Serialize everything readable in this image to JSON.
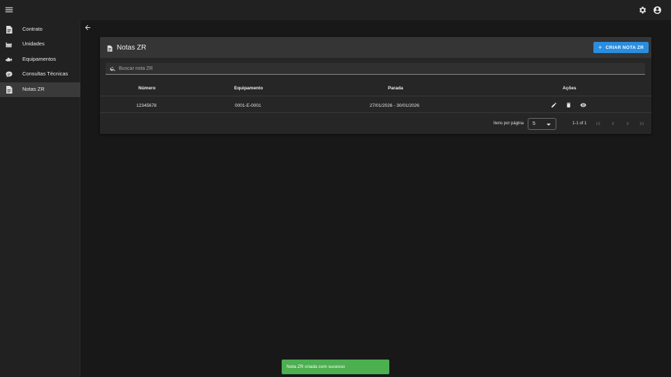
{
  "topbar": {
    "menu_icon": "menu-icon",
    "settings_icon": "gear-icon",
    "account_icon": "account-circle-icon"
  },
  "sidebar": {
    "items": [
      {
        "label": "Contrato",
        "icon": "file-document-icon",
        "active": false
      },
      {
        "label": "Unidades",
        "icon": "factory-icon",
        "active": false
      },
      {
        "label": "Equipamentos",
        "icon": "pump-icon",
        "active": false
      },
      {
        "label": "Consultas Técnicas",
        "icon": "chat-bubble-icon",
        "active": false
      },
      {
        "label": "Notas ZR",
        "icon": "file-document-icon",
        "active": true
      }
    ]
  },
  "main": {
    "back_icon": "arrow-left-icon",
    "card": {
      "title": "Notas ZR",
      "title_icon": "file-document-icon",
      "create_button": {
        "icon": "plus-icon",
        "label": "CRIAR NOTA ZR"
      },
      "search": {
        "placeholder": "Buscar nota ZR",
        "value": "",
        "icon": "search-icon"
      },
      "table": {
        "headers": {
          "numero": "Número",
          "equipamento": "Equipamento",
          "parada": "Parada",
          "acoes": "Ações"
        },
        "rows": [
          {
            "numero": "12345678",
            "equipamento": "0001-E-0001",
            "parada": "27/01/2026 - 30/01/2026",
            "actions": [
              "pencil-icon",
              "trash-icon",
              "eye-icon"
            ]
          }
        ]
      },
      "pagination": {
        "items_per_page_label": "Itens por página",
        "items_per_page_value": "5",
        "range_label": "1-1 of 1",
        "buttons": [
          "first-page-icon",
          "previous-page-icon",
          "next-page-icon",
          "last-page-icon"
        ]
      }
    }
  },
  "toast": {
    "message": "Nota ZR criada com sucesso"
  },
  "colors": {
    "background": "#181818",
    "topbar": "#212121",
    "card": "#262626",
    "card_header": "#353535",
    "accent": "#2a8ee0",
    "success": "#4caf50",
    "active_item": "#3a3a3a"
  }
}
